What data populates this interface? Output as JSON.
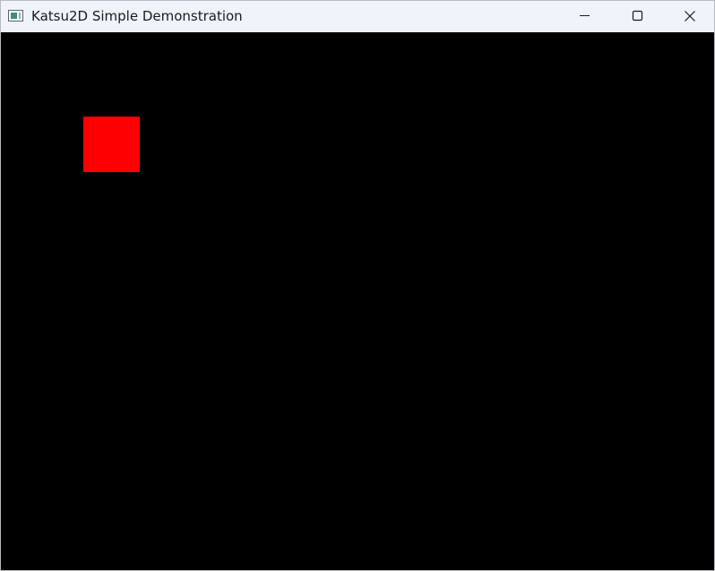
{
  "window": {
    "title": "Katsu2D Simple Demonstration",
    "background_color": "#000000",
    "titlebar_color": "#eff3fa",
    "controls": [
      "minimize-icon",
      "maximize-icon",
      "close-icon"
    ]
  },
  "scene": {
    "sprite": {
      "shape": "square",
      "color": "#ff0000"
    }
  }
}
